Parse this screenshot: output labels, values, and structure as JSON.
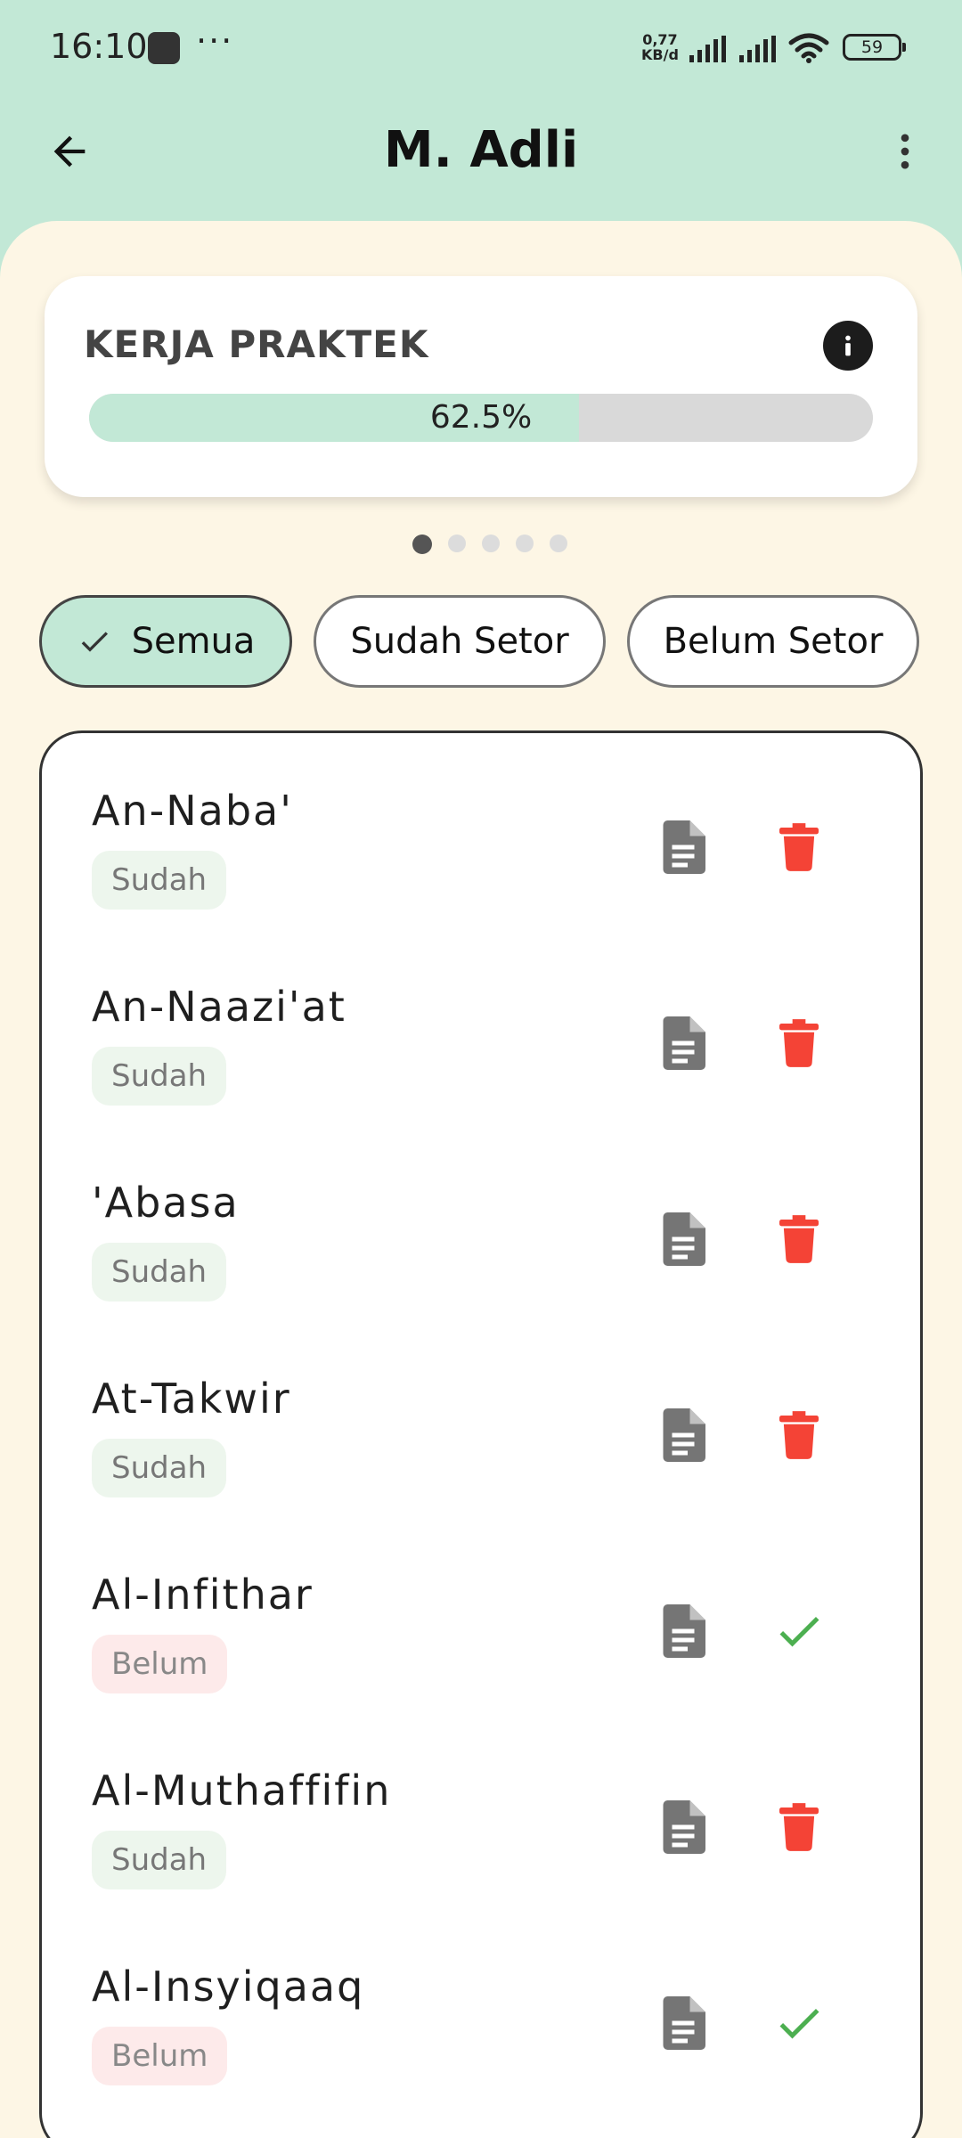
{
  "status_bar": {
    "time": "16:10",
    "more": "···",
    "net_speed_value": "0,77",
    "net_speed_unit": "KB/d",
    "battery": "59"
  },
  "app_bar": {
    "title": "M. Adli",
    "back_icon": "arrow-left-icon",
    "more_icon": "more-vert-icon"
  },
  "progress_card": {
    "title": "KERJA PRAKTEK",
    "progress_label": "62.5%",
    "progress_fraction": 0.625,
    "info_icon": "info-icon"
  },
  "pager": {
    "count": 5,
    "active_index": 0
  },
  "filters": [
    {
      "label": "Semua",
      "selected": true
    },
    {
      "label": "Sudah Setor",
      "selected": false
    },
    {
      "label": "Belum Setor",
      "selected": false
    }
  ],
  "surah_list": [
    {
      "name": "An-Naba'",
      "status": "Sudah",
      "action": "delete"
    },
    {
      "name": "An-Naazi'at",
      "status": "Sudah",
      "action": "delete"
    },
    {
      "name": "'Abasa",
      "status": "Sudah",
      "action": "delete"
    },
    {
      "name": "At-Takwir",
      "status": "Sudah",
      "action": "delete"
    },
    {
      "name": "Al-Infithar",
      "status": "Belum",
      "action": "check"
    },
    {
      "name": "Al-Muthaffifin",
      "status": "Sudah",
      "action": "delete"
    },
    {
      "name": "Al-Insyiqaaq",
      "status": "Belum",
      "action": "check"
    }
  ],
  "colors": {
    "header_bg": "#c2e8d6",
    "sheet_bg": "#fdf6e5",
    "progress_fill": "#c2e8d6",
    "progress_track": "#d9d9d9",
    "delete_red": "#f44336",
    "check_green": "#4caf50",
    "doc_gray": "#757575"
  }
}
